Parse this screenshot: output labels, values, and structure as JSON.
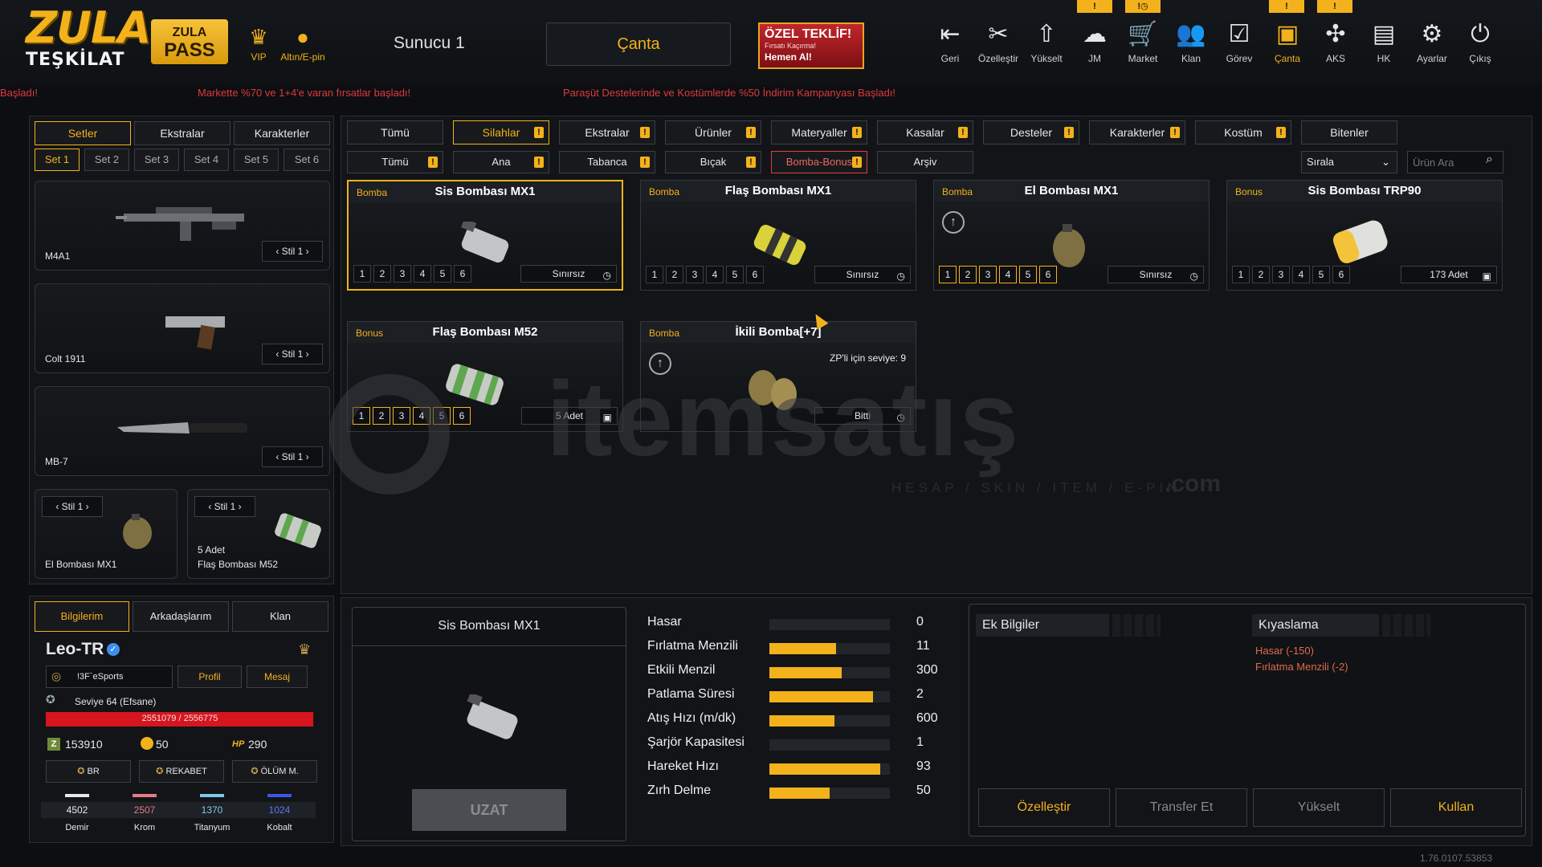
{
  "header": {
    "logo_main": "ZULA",
    "logo_sub": "TEŞKİLAT",
    "pass_line1": "ZULA",
    "pass_line2": "PASS",
    "vip_label": "VIP",
    "gold_label": "Altın/E-pin",
    "server": "Sunucu 1",
    "bag_button": "Çanta",
    "offer_title": "ÖZEL TEKLİF!",
    "offer_sub": "Fırsatı Kaçırma!",
    "offer_cta": "Hemen Al!",
    "nav": [
      {
        "label": "Geri",
        "icon": "back-icon",
        "glyph": "⇤"
      },
      {
        "label": "Özelleştir",
        "icon": "tools-icon",
        "glyph": "✂"
      },
      {
        "label": "Yükselt",
        "icon": "upgrade-icon",
        "glyph": "⇧"
      },
      {
        "label": "JM",
        "icon": "jm-icon",
        "glyph": "☁"
      },
      {
        "label": "Market",
        "icon": "cart-icon",
        "glyph": "🛒"
      },
      {
        "label": "Klan",
        "icon": "clan-icon",
        "glyph": "👥"
      },
      {
        "label": "Görev",
        "icon": "mission-icon",
        "glyph": "☑"
      },
      {
        "label": "Çanta",
        "icon": "bag-icon",
        "glyph": "▣"
      },
      {
        "label": "AKS",
        "icon": "aks-icon",
        "glyph": "✣"
      },
      {
        "label": "HK",
        "icon": "wallet-icon",
        "glyph": "▤"
      },
      {
        "label": "Ayarlar",
        "icon": "gear-icon",
        "glyph": "⚙"
      },
      {
        "label": "Çıkış",
        "icon": "power-icon",
        "glyph": "⏻"
      }
    ],
    "badges": [
      "!",
      "!◷",
      "!",
      "!"
    ]
  },
  "ticker": [
    "Başladı!",
    "Markette %70 ve 1+4'e varan fırsatlar başladı!",
    "Paraşüt Destelerinde ve Kostümlerde %50 İndirim Kampanyası Başladı!"
  ],
  "left": {
    "tabs": [
      "Setler",
      "Ekstralar",
      "Karakterler"
    ],
    "sets": [
      "Set 1",
      "Set 2",
      "Set 3",
      "Set 4",
      "Set 5",
      "Set 6"
    ],
    "slots": [
      {
        "name": "M4A1",
        "style": "Stil 1"
      },
      {
        "name": "Colt 1911",
        "style": "Stil 1"
      },
      {
        "name": "MB-7",
        "style": "Stil 1"
      }
    ],
    "small_slots": [
      {
        "name": "El Bombası MX1",
        "style": "Stil 1",
        "count": ""
      },
      {
        "name": "Flaş Bombası M52",
        "style": "Stil 1",
        "count": "5 Adet"
      }
    ]
  },
  "profile": {
    "tabs": [
      "Bilgilerim",
      "Arkadaşlarım",
      "Klan"
    ],
    "username": "Leo-TR",
    "clan": "!3F`eSports",
    "profile_btn": "Profil",
    "message_btn": "Mesaj",
    "level": "Seviye 64 (Efsane)",
    "xp": "2551079 / 2556775",
    "xp_progress": 0.998,
    "zp": "153910",
    "gold": "50",
    "hp_label": "HP",
    "hp": "290",
    "modes": [
      "BR",
      "REKABET",
      "ÖLÜM M."
    ],
    "resources": [
      {
        "name": "Demir",
        "value": "4502",
        "color": "#e8e8e8"
      },
      {
        "name": "Krom",
        "value": "2507",
        "color": "#e57b86"
      },
      {
        "name": "Titanyum",
        "value": "1370",
        "color": "#7ec9e8"
      },
      {
        "name": "Kobalt",
        "value": "1024",
        "color": "#3f57e6"
      }
    ]
  },
  "categories": {
    "row1": [
      "Tümü",
      "Silahlar",
      "Ekstralar",
      "Ürünler",
      "Materyaller",
      "Kasalar",
      "Desteler",
      "Karakterler",
      "Kostüm",
      "Bitenler"
    ],
    "row2": [
      "Tümü",
      "Ana",
      "Tabanca",
      "Bıçak",
      "Bomba-Bonus",
      "Arşiv"
    ],
    "sort_label": "Sırala",
    "search_placeholder": "Ürün Ara"
  },
  "items": [
    {
      "cat": "Bomba",
      "name": "Sis Bombası MX1",
      "dur": "Sınırsız",
      "dur_icon": "◷"
    },
    {
      "cat": "Bomba",
      "name": "Flaş Bombası MX1",
      "dur": "Sınırsız",
      "dur_icon": "◷"
    },
    {
      "cat": "Bomba",
      "name": "El Bombası MX1",
      "dur": "Sınırsız",
      "dur_icon": "◷"
    },
    {
      "cat": "Bonus",
      "name": "Sis Bombası TRP90",
      "dur": "173 Adet",
      "dur_icon": "▣"
    },
    {
      "cat": "Bonus",
      "name": "Flaş Bombası M52",
      "dur": "5 Adet",
      "dur_icon": "▣"
    },
    {
      "cat": "Bomba",
      "name": "İkili Bomba[+7]",
      "dur": "Bitti",
      "dur_icon": "◷",
      "req": "ZP'li için seviye: 9"
    }
  ],
  "slot_numbers": [
    "1",
    "2",
    "3",
    "4",
    "5",
    "6"
  ],
  "detail": {
    "title": "Sis Bombası MX1",
    "extend_btn": "UZAT",
    "stats": [
      {
        "label": "Hasar",
        "value": "0",
        "fill": 0
      },
      {
        "label": "Fırlatma Menzili",
        "value": "11",
        "fill": 0.55
      },
      {
        "label": "Etkili Menzil",
        "value": "300",
        "fill": 0.6
      },
      {
        "label": "Patlama Süresi",
        "value": "2",
        "fill": 0.86
      },
      {
        "label": "Atış Hızı (m/dk)",
        "value": "600",
        "fill": 0.54
      },
      {
        "label": "Şarjör Kapasitesi",
        "value": "1",
        "fill": 0
      },
      {
        "label": "Hareket Hızı",
        "value": "93",
        "fill": 0.92
      },
      {
        "label": "Zırh Delme",
        "value": "50",
        "fill": 0.5
      }
    ],
    "extra_title": "Ek Bilgiler",
    "compare_title": "Kıyaslama",
    "compare": [
      "Hasar (-150)",
      "Fırlatma Menzili (-2)"
    ],
    "actions": [
      "Özelleştir",
      "Transfer Et",
      "Yükselt",
      "Kullan"
    ]
  },
  "watermark": {
    "brand": "itemsatış",
    "tagline": "HESAP / SKIN / ITEM / E-PIN",
    "suffix": ".com"
  },
  "version": "1.76.0107.53853",
  "colors": {
    "accent": "#f3b21b",
    "ticker": "#e0393e",
    "xp_bar": "#d7151f"
  }
}
